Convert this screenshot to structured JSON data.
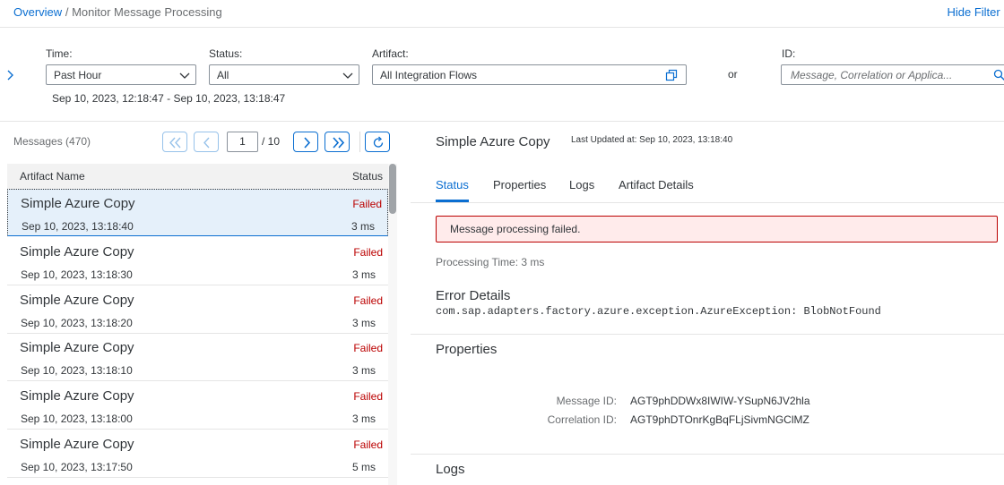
{
  "breadcrumb": {
    "overview": "Overview",
    "separator": "/",
    "current": "Monitor Message Processing"
  },
  "header": {
    "hide_filter": "Hide Filter B"
  },
  "filters": {
    "time_label": "Time:",
    "time_value": "Past Hour",
    "status_label": "Status:",
    "status_value": "All",
    "artifact_label": "Artifact:",
    "artifact_value": "All Integration Flows",
    "or_text": "or",
    "id_label": "ID:",
    "id_placeholder": "Message, Correlation or Applica...",
    "range": "Sep 10, 2023, 12:18:47 - Sep 10, 2023, 13:18:47"
  },
  "messages": {
    "title": "Messages (470)",
    "page_current": "1",
    "page_total": "/ 10",
    "col_name": "Artifact Name",
    "col_status": "Status",
    "items": [
      {
        "name": "Simple Azure Copy",
        "status": "Failed",
        "date": "Sep 10, 2023, 13:18:40",
        "duration": "3 ms"
      },
      {
        "name": "Simple Azure Copy",
        "status": "Failed",
        "date": "Sep 10, 2023, 13:18:30",
        "duration": "3 ms"
      },
      {
        "name": "Simple Azure Copy",
        "status": "Failed",
        "date": "Sep 10, 2023, 13:18:20",
        "duration": "3 ms"
      },
      {
        "name": "Simple Azure Copy",
        "status": "Failed",
        "date": "Sep 10, 2023, 13:18:10",
        "duration": "3 ms"
      },
      {
        "name": "Simple Azure Copy",
        "status": "Failed",
        "date": "Sep 10, 2023, 13:18:00",
        "duration": "3 ms"
      },
      {
        "name": "Simple Azure Copy",
        "status": "Failed",
        "date": "Sep 10, 2023, 13:17:50",
        "duration": "5 ms"
      }
    ]
  },
  "detail": {
    "title": "Simple Azure Copy",
    "last_updated": "Last Updated at: Sep 10, 2023, 13:18:40",
    "tabs": [
      "Status",
      "Properties",
      "Logs",
      "Artifact Details"
    ],
    "error_banner": "Message processing failed.",
    "processing_time": "Processing Time: 3 ms",
    "error_details_heading": "Error Details",
    "error_text": "com.sap.adapters.factory.azure.exception.AzureException: BlobNotFound",
    "properties_heading": "Properties",
    "message_id_label": "Message ID:",
    "message_id": "AGT9phDDWx8IWIW-YSupN6JV2hla",
    "correlation_id_label": "Correlation ID:",
    "correlation_id": "AGT9phDTOnrKgBqFLjSivmNGClMZ",
    "logs_heading": "Logs"
  },
  "colors": {
    "accent": "#0a6ed1",
    "error": "#bb0000",
    "error_bg": "#ffebeb",
    "selected_bg": "#e5f0fa"
  }
}
